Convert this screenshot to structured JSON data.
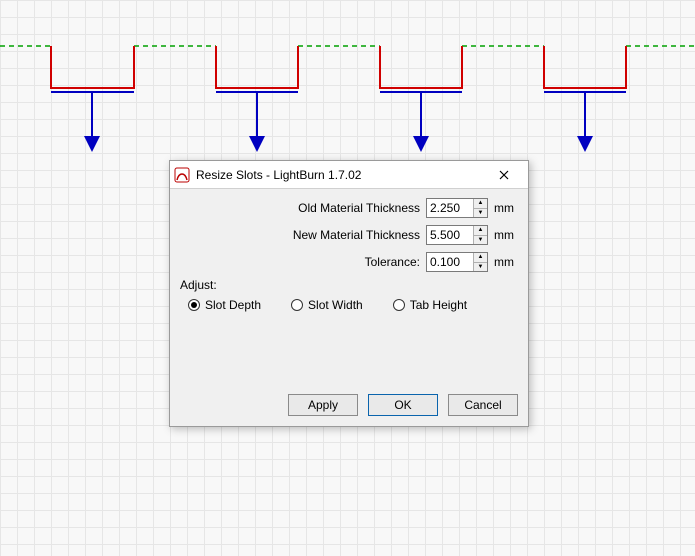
{
  "dialog": {
    "title": "Resize Slots - LightBurn 1.7.02",
    "fields": {
      "old_thickness": {
        "label": "Old Material Thickness",
        "value": "2.250",
        "unit": "mm"
      },
      "new_thickness": {
        "label": "New Material Thickness",
        "value": "5.500",
        "unit": "mm"
      },
      "tolerance": {
        "label": "Tolerance:",
        "value": "0.100",
        "unit": "mm"
      }
    },
    "adjust_label": "Adjust:",
    "radios": {
      "slot_depth": "Slot Depth",
      "slot_width": "Slot Width",
      "tab_height": "Tab Height",
      "selected": "slot_depth"
    },
    "buttons": {
      "apply": "Apply",
      "ok": "OK",
      "cancel": "Cancel"
    }
  },
  "canvas": {
    "grid_color": "#e6e6e6",
    "dash_color": "#00a000",
    "slot_color": "#d00000",
    "bracket_color": "#0000c0",
    "arrow_color": "#0000c0"
  }
}
